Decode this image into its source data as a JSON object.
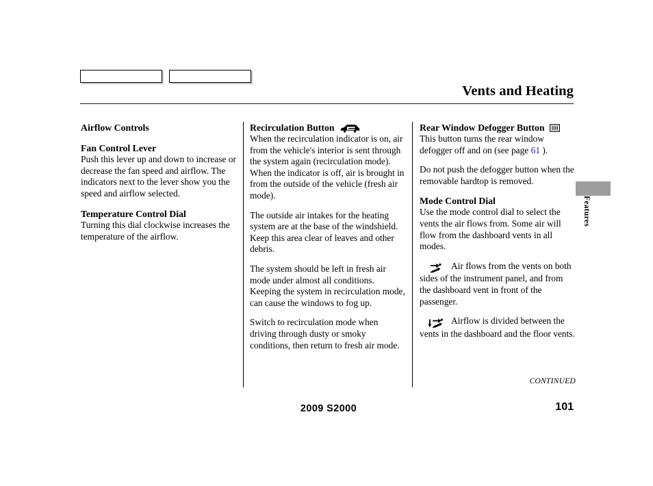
{
  "header": {
    "title": "Vents and Heating",
    "nav_boxes": [
      {
        "label": ""
      },
      {
        "label": ""
      }
    ]
  },
  "column_1": {
    "section_title": "Airflow Controls",
    "blocks": [
      {
        "heading": "Fan Control Lever",
        "text": "Push this lever up and down to increase or decrease the fan speed and airflow. The indicators next to the lever show you the speed and airflow selected."
      },
      {
        "heading": "Temperature Control Dial",
        "text": "Turning this dial clockwise increases the temperature of the airflow."
      }
    ]
  },
  "column_2": {
    "heading": "Recirculation Button",
    "heading_icon": "recirculation-car-icon",
    "paragraphs": [
      "When the recirculation indicator is on, air from the vehicle's interior is sent through the system again (recirculation mode). When the indicator is off, air is brought in from the outside of the vehicle (fresh air mode).",
      "The outside air intakes for the heating system are at the base of the windshield. Keep this area clear of leaves and other debris.",
      "The system should be left in fresh air mode under almost all conditions. Keeping the system in recirculation mode, can cause the windows to fog up.",
      "Switch to recirculation mode when driving through dusty or smoky conditions, then return to fresh air mode."
    ]
  },
  "column_3": {
    "heading": "Rear Window Defogger Button",
    "heading_icon": "rear-defogger-icon",
    "defogger_text_before": "This button turns the rear window defogger off and on (see page",
    "page_link": "61",
    "defogger_text_after": ").",
    "defogger_warning": "Do not push the defogger button when the removable hardtop is removed.",
    "mode_heading": "Mode Control Dial",
    "mode_intro": "Use the mode control dial to select the vents the air flows from. Some air will flow from the dashboard vents in all modes.",
    "modes": [
      {
        "icon": "vent-dashboard-airflow-icon",
        "text": "Air flows from the vents on both sides of the instrument panel, and from the dashboard vent in front of the passenger."
      },
      {
        "icon": "vent-dashboard-floor-airflow-icon",
        "text": "Airflow is divided between the vents in the dashboard and the floor vents."
      }
    ]
  },
  "side_tab": {
    "label": "Features",
    "color": "#9e9e9e"
  },
  "footer": {
    "continued": "CONTINUED",
    "model": "2009 S2000",
    "page_number": "101"
  },
  "colors": {
    "link": "#2323cc",
    "text": "#000000",
    "tab_gray": "#9e9e9e"
  }
}
